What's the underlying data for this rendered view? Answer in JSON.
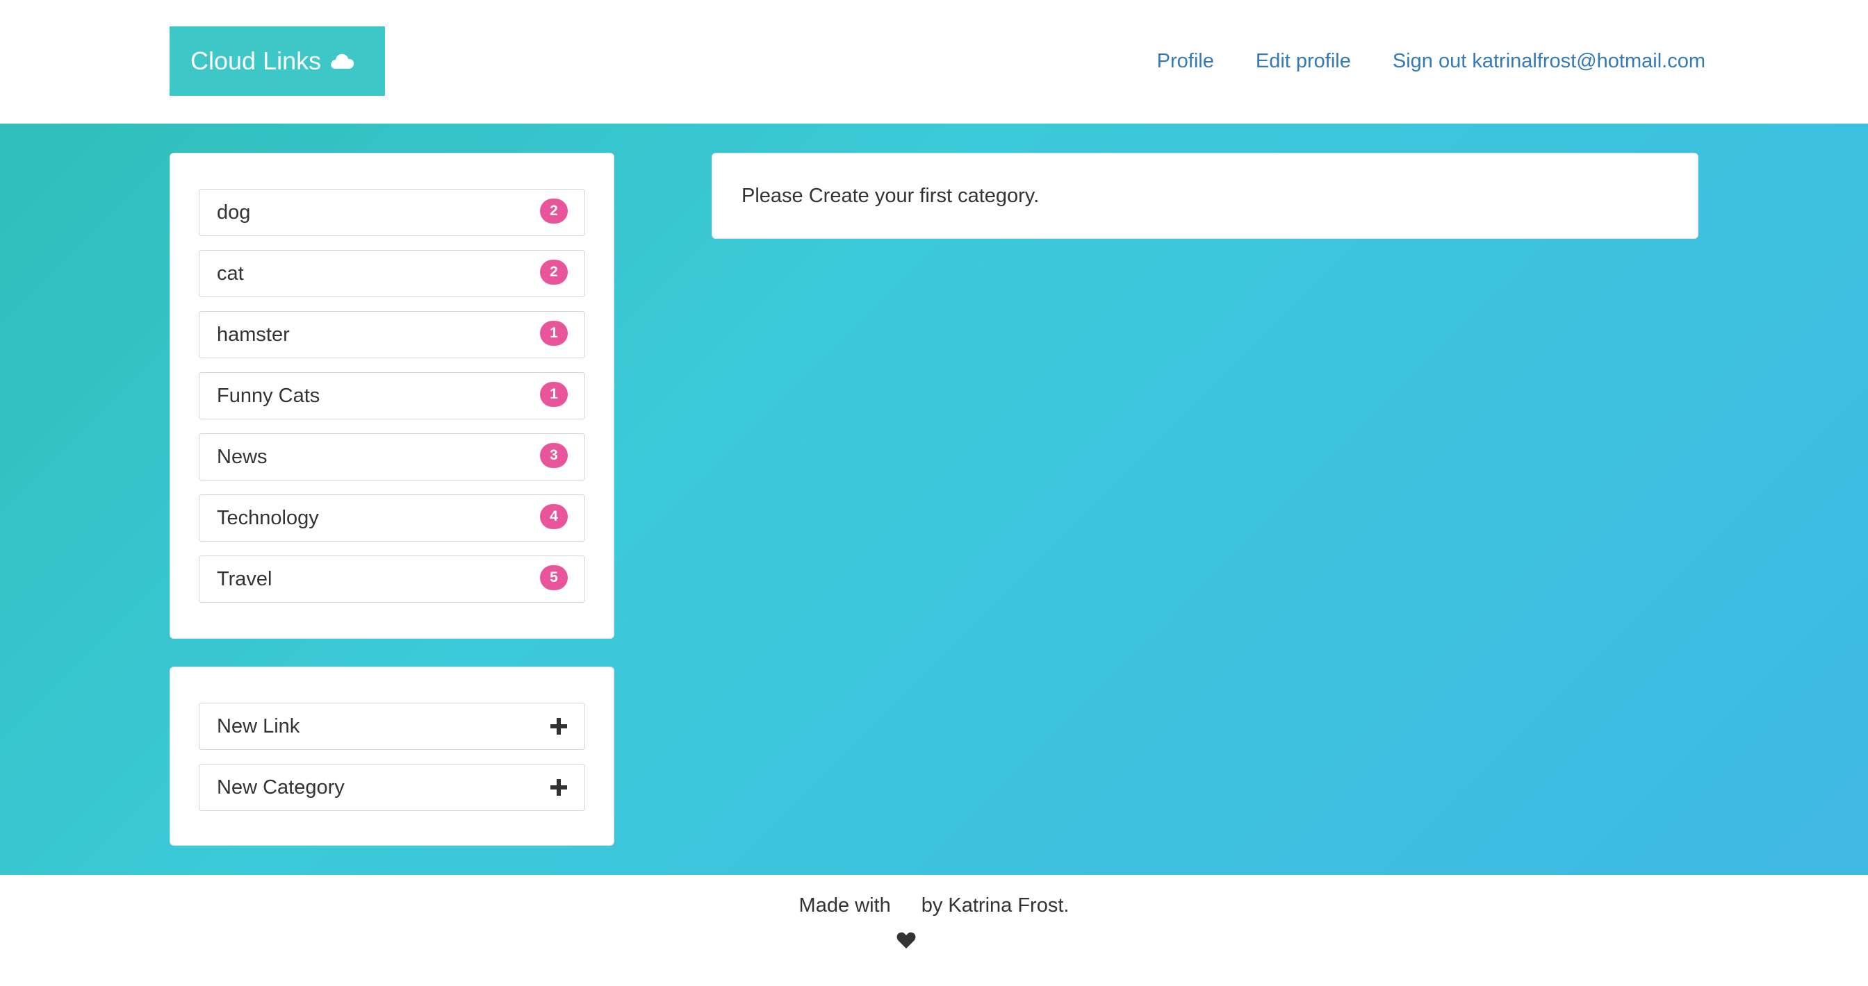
{
  "brand": {
    "title": "Cloud Links",
    "icon": "cloud-icon",
    "color": "#3ec7c7"
  },
  "nav": {
    "profile": "Profile",
    "edit_profile": "Edit profile",
    "sign_out": "Sign out katrinalfrost@hotmail.com",
    "link_color": "#337ab7"
  },
  "categories": [
    {
      "label": "dog",
      "count": "2"
    },
    {
      "label": "cat",
      "count": "2"
    },
    {
      "label": "hamster",
      "count": "1"
    },
    {
      "label": "Funny Cats",
      "count": "1"
    },
    {
      "label": "News",
      "count": "3"
    },
    {
      "label": "Technology",
      "count": "4"
    },
    {
      "label": "Travel",
      "count": "5"
    }
  ],
  "actions": [
    {
      "label": "New Link",
      "icon": "plus-icon"
    },
    {
      "label": "New Category",
      "icon": "plus-icon"
    }
  ],
  "message": "Please Create your first category.",
  "footer": {
    "prefix": "Made with",
    "icon": "heart-icon",
    "suffix": "by Katrina Frost."
  },
  "colors": {
    "badge": "#e8559b",
    "gradient_start": "#2fbeb9",
    "gradient_end": "#3fb8e4"
  }
}
